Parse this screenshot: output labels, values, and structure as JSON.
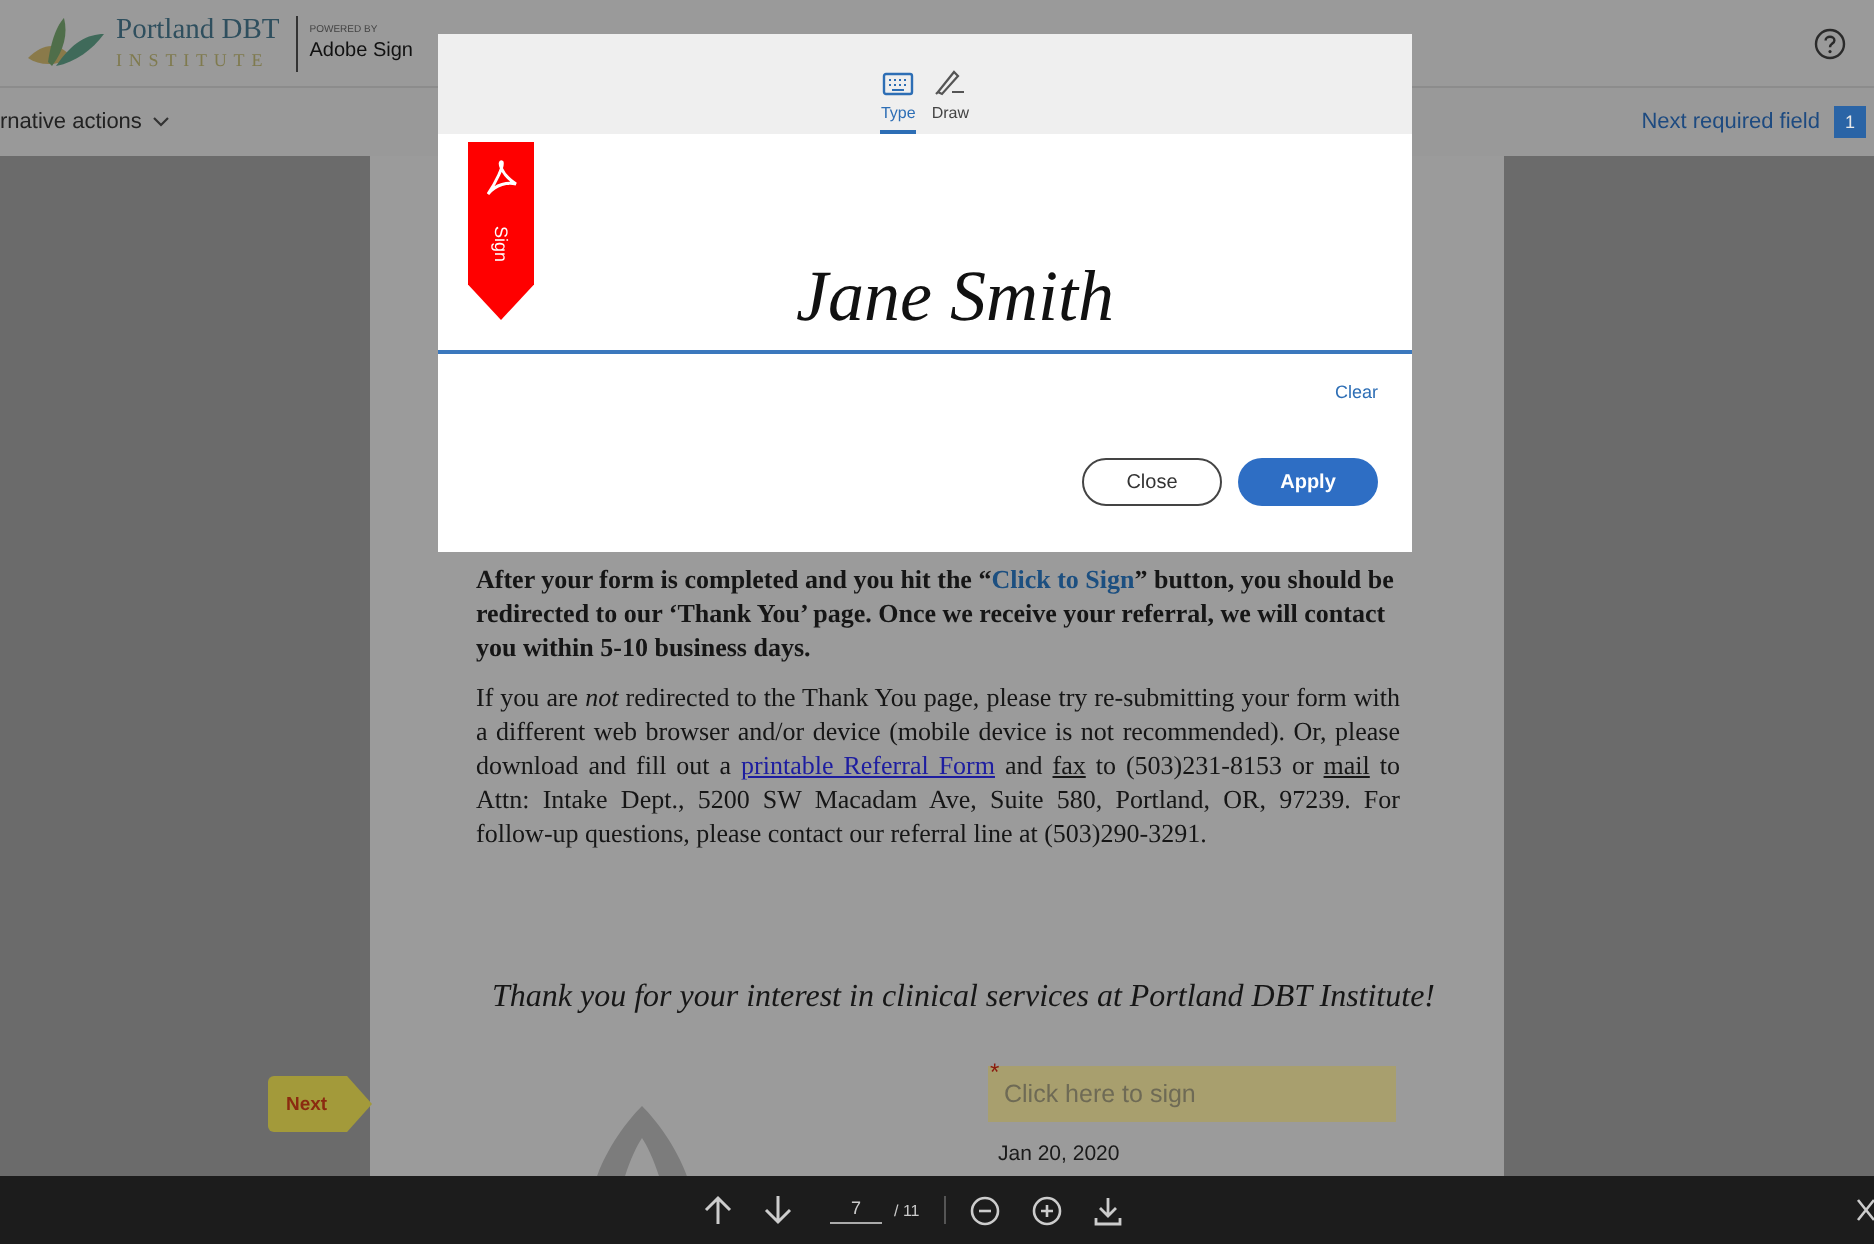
{
  "header": {
    "logo_name": "Portland DBT",
    "logo_subtitle": "INSTITUTE",
    "powered_by": "POWERED BY",
    "product": "Adobe Sign"
  },
  "toolbar": {
    "actions_menu": "rnative actions",
    "next_required": "Next required field",
    "required_count": "1"
  },
  "document": {
    "paragraphs": [
      {
        "kind": "bold",
        "segments": [
          {
            "kind": "text",
            "text": "After your form is completed and you hit the “"
          },
          {
            "kind": "highlight",
            "text": "Click to Sign"
          },
          {
            "kind": "text",
            "text": "” button, you should be redirected to our ‘Thank You’ page.  Once we receive your referral, we will contact you within 5-10 business days."
          }
        ]
      },
      {
        "kind": "plain",
        "segments": [
          {
            "kind": "text",
            "text": "If you are *not* redirected to the Thank You page, please try re-submitting your form with a different web browser and/or device (mobile device is not recommended). Or, please download and fill out a "
          },
          {
            "kind": "link",
            "text": "printable Referral Form"
          },
          {
            "kind": "text",
            "text": " and "
          },
          {
            "kind": "underline",
            "text": "fax"
          },
          {
            "kind": "text",
            "text": " to (503)231-8153 or "
          },
          {
            "kind": "underline",
            "text": "mail"
          },
          {
            "kind": "text",
            "text": " to Attn: Intake Dept., 5200 SW Macadam Ave, Suite 580, Portland, OR, 97239.  For follow-up questions, please contact our referral line at (503)290-3291."
          }
        ]
      }
    ],
    "closing": "Thank you for your interest in clinical services at Portland DBT Institute!",
    "next_tag": "Next",
    "sign_field": {
      "placeholder": "Click here to sign",
      "required": true,
      "required_mark": "*"
    },
    "date": "Jan 20, 2020"
  },
  "dialog": {
    "tabs": [
      {
        "kind": "keyboard",
        "label": "Type",
        "selected": true
      },
      {
        "kind": "pen",
        "label": "Draw",
        "selected": false
      }
    ],
    "bookmark_label": "Sign",
    "signature": "Jane Smith",
    "clear": "Clear",
    "buttons": [
      {
        "kind": "secondary",
        "label": "Close"
      },
      {
        "kind": "primary",
        "label": "Apply"
      }
    ]
  },
  "footer": {
    "page": "7",
    "total": "/ 11"
  }
}
